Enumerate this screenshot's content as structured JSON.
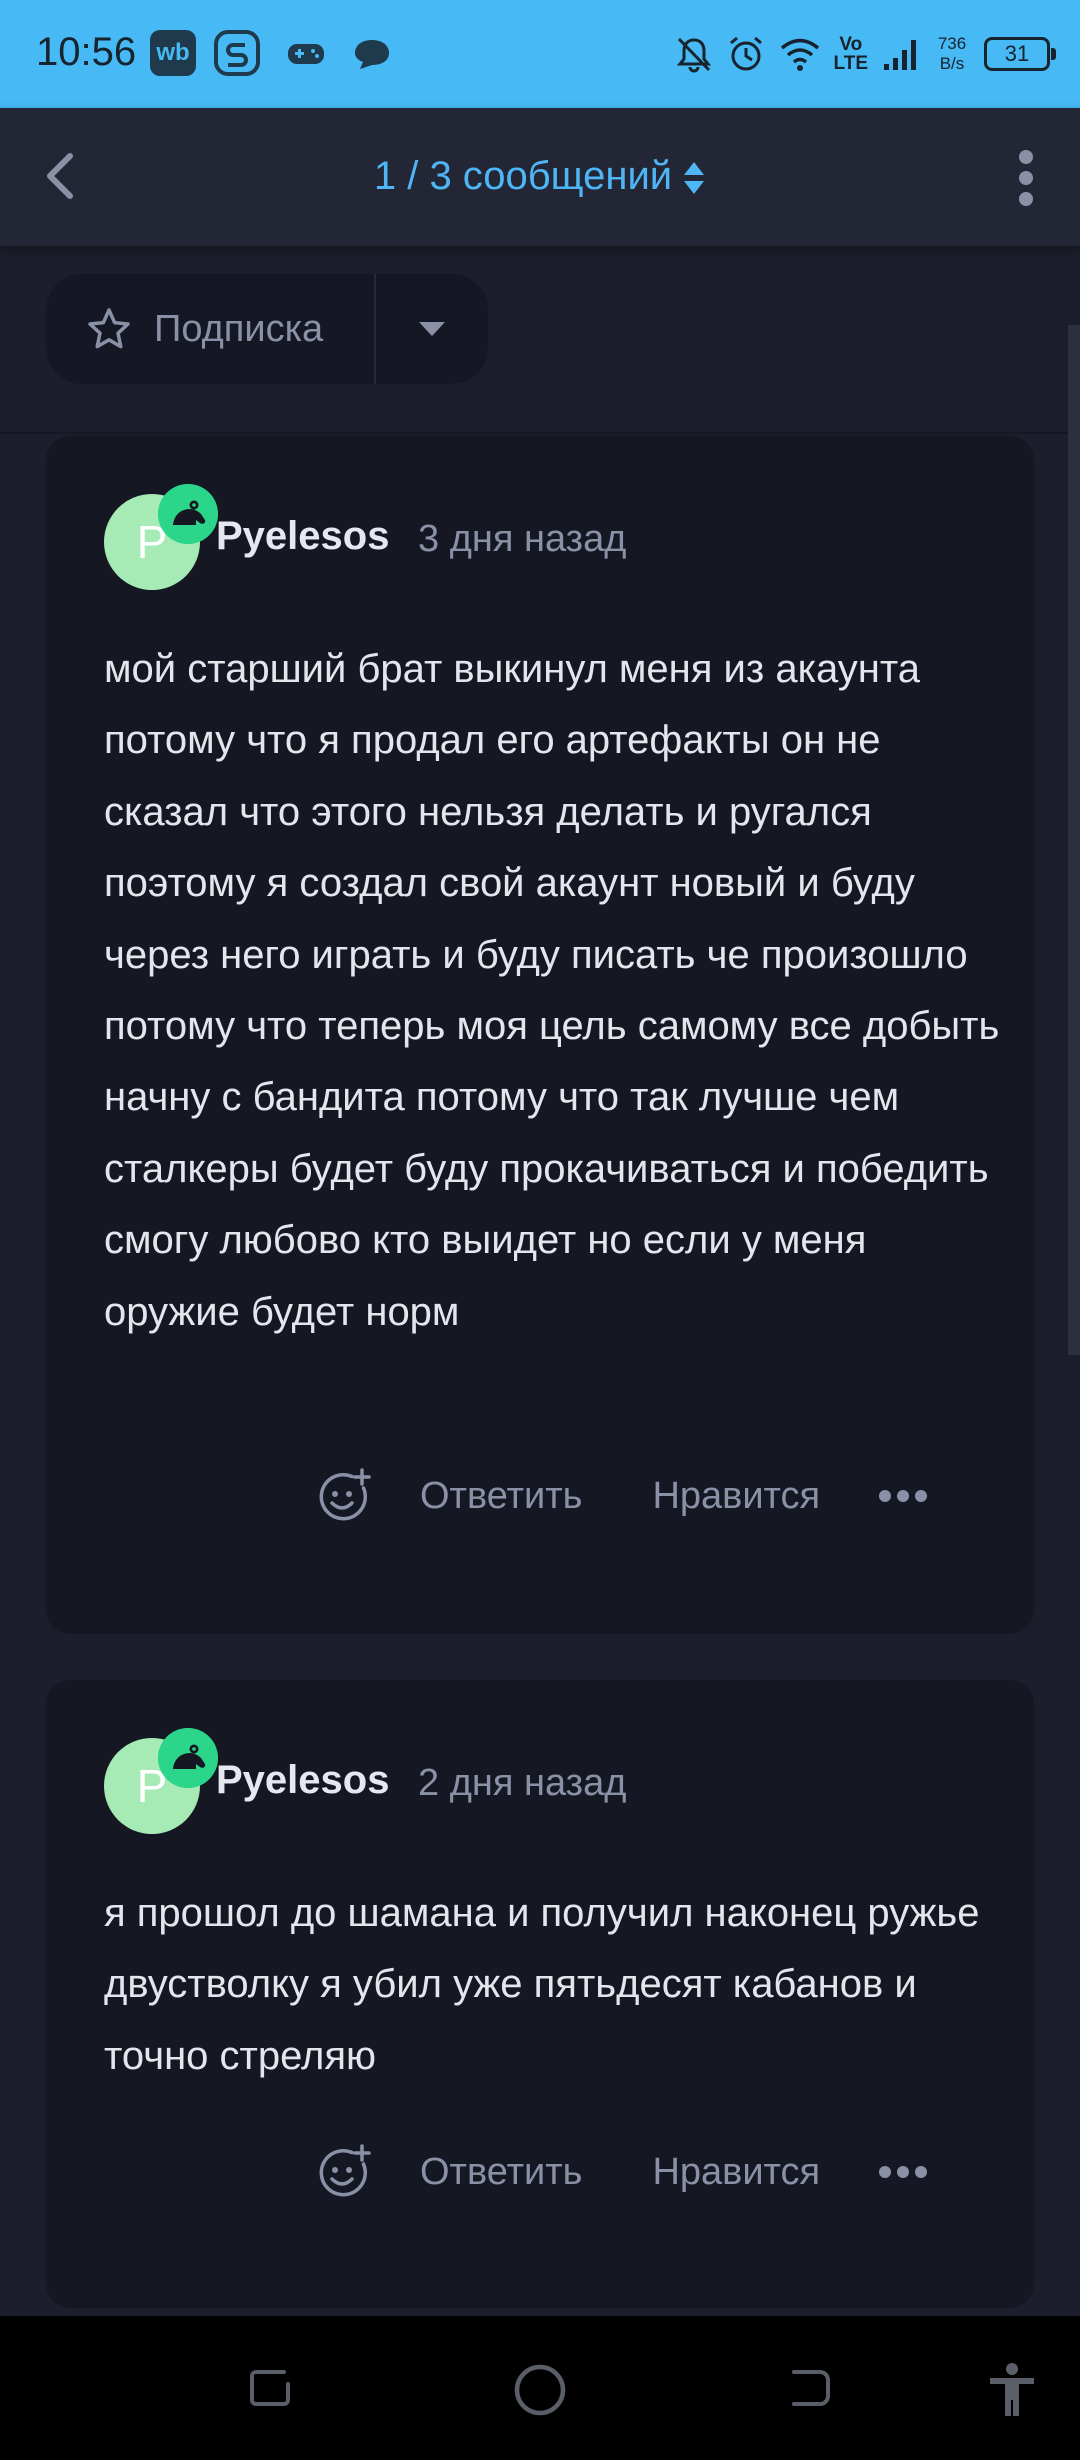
{
  "status_bar": {
    "time": "10:56",
    "app_icons": [
      "wb-icon",
      "s-app-icon",
      "gamepad-icon",
      "chat-bubble-icon"
    ],
    "wb_label": "wb",
    "network_type": "Vo\nLTE",
    "net_speed": "736\nB/s",
    "battery": "31"
  },
  "header": {
    "title": "1 / 3 сообщений"
  },
  "subscribe": {
    "label": "Подписка"
  },
  "posts": [
    {
      "avatar_letter": "P",
      "author": "Pyelesos",
      "time": "3 дня назад",
      "body": "мой старший брат выкинул меня из акаунта потому что я продал его артефакты он не сказал что этого нельзя делать и ругался поэтому я создал свой акаунт новый и буду через него играть и буду писать че произошло потому что теперь моя цель самому все добыть начну с бандита потому что так лучше чем сталкеры будет буду прокачиваться и победить смогу любово кто выидет но если у меня оружие будет норм",
      "reply_label": "Ответить",
      "like_label": "Нравится"
    },
    {
      "avatar_letter": "P",
      "author": "Pyelesos",
      "time": "2 дня назад",
      "body": "я прошол до шамана и получил наконец ружье двустволку я убил уже пятьдесят кабанов и точно стреляю",
      "reply_label": "Ответить",
      "like_label": "Нравится"
    }
  ],
  "colors": {
    "status_bar": "#47b9f4",
    "accent": "#4fb6f5",
    "background": "#1c1f2b",
    "card": "#151823",
    "badge": "#2bd58a",
    "avatar": "#a6eab6"
  }
}
